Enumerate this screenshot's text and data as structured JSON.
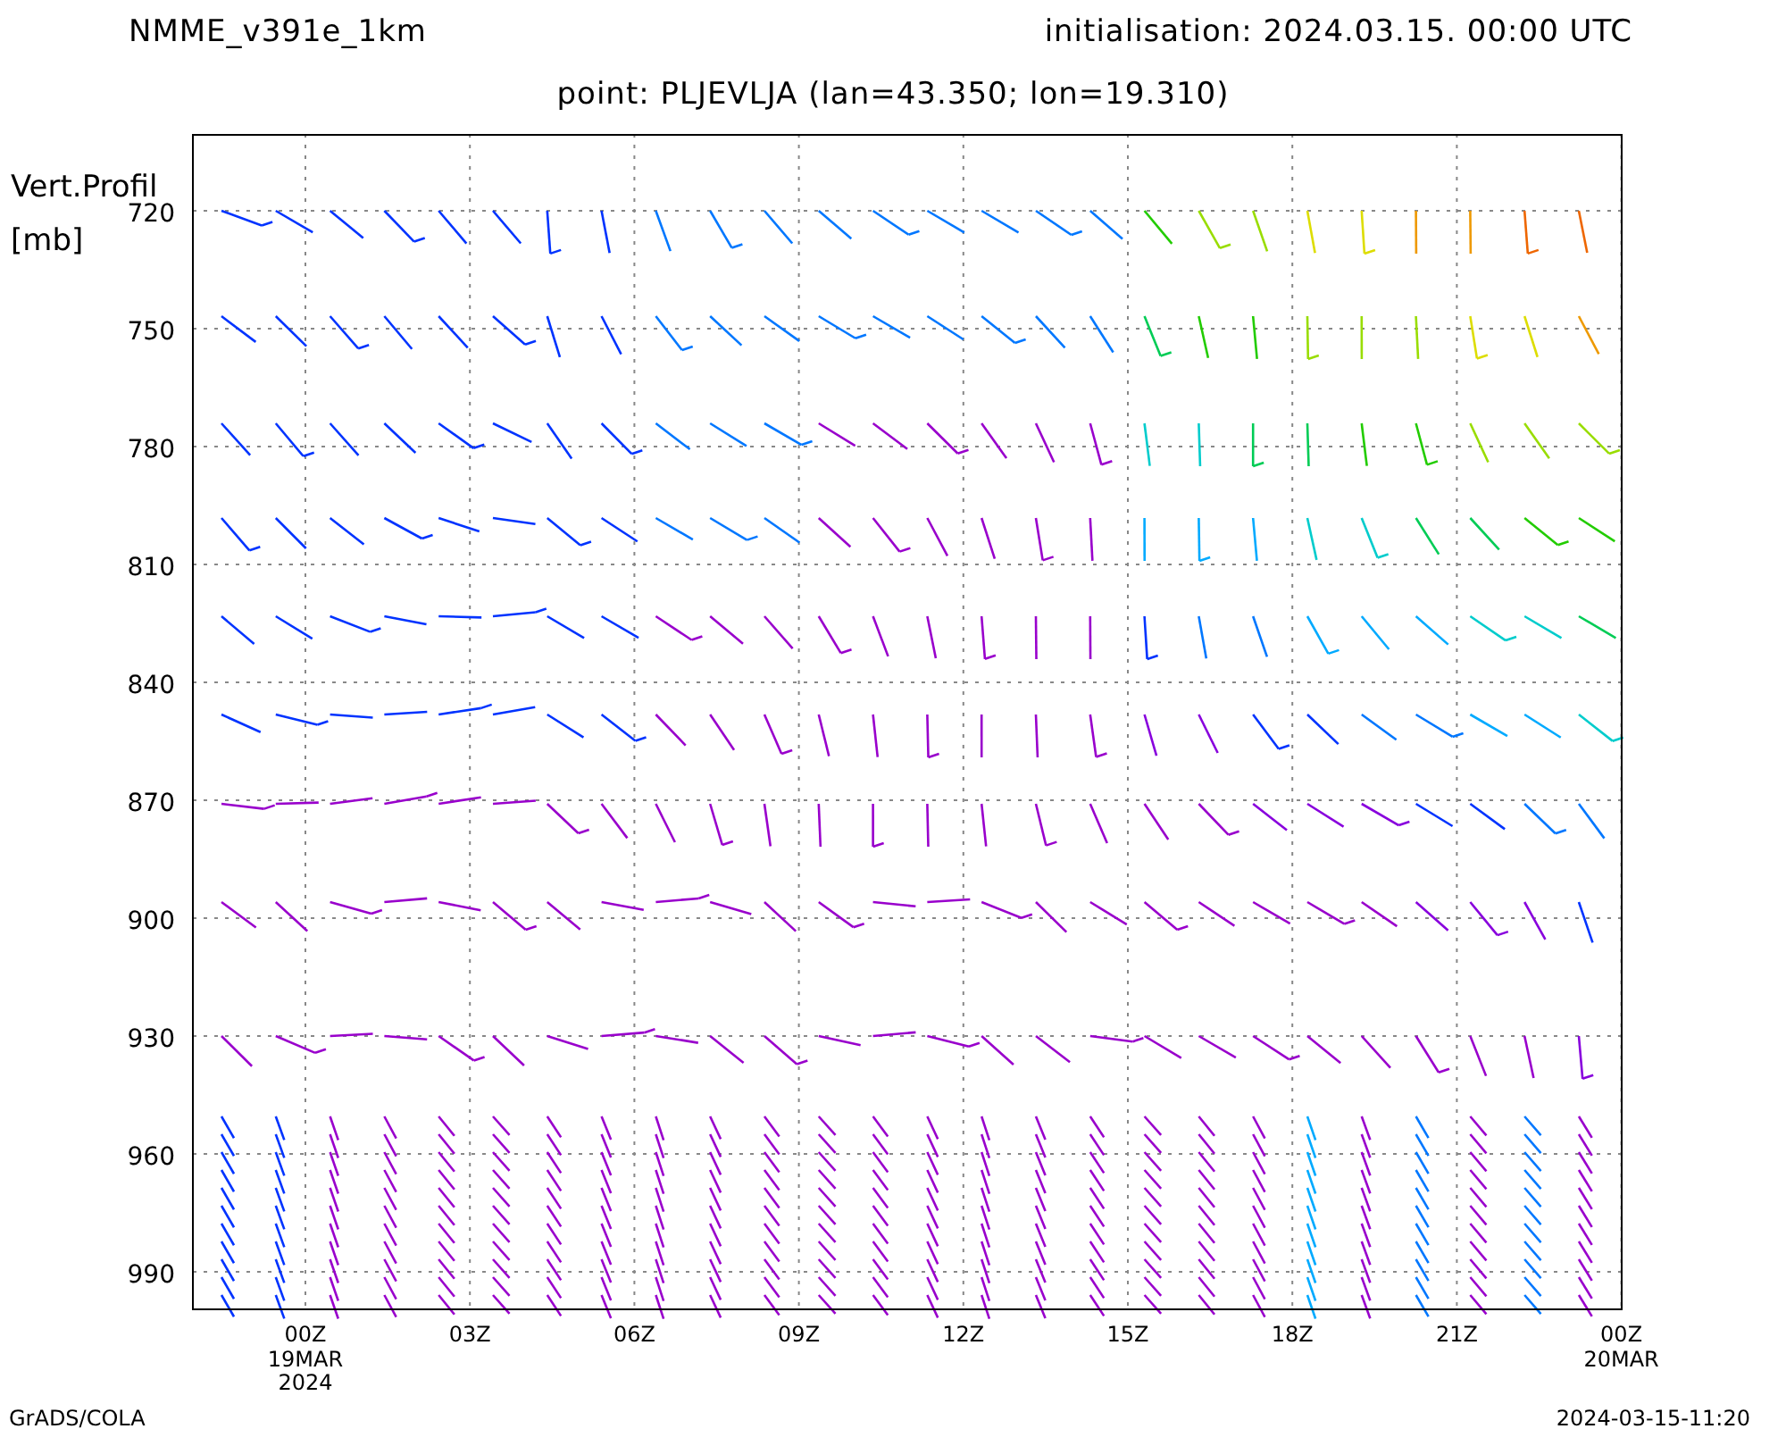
{
  "header": {
    "title": "NMME_v391e_1km",
    "initialisation": "initialisation: 2024.03.15. 00:00 UTC"
  },
  "subtitle": "point: PLJEVLJA (lan=43.350; lon=19.310)",
  "y_axis": {
    "label_lines": [
      "Vert.Profil",
      "[mb]"
    ],
    "ticks": [
      "720",
      "750",
      "780",
      "810",
      "840",
      "870",
      "900",
      "930",
      "960",
      "990"
    ]
  },
  "x_axis": {
    "ticks": [
      {
        "label": "00Z",
        "sub": [
          "19MAR",
          "2024"
        ]
      },
      {
        "label": "03Z"
      },
      {
        "label": "06Z"
      },
      {
        "label": "09Z"
      },
      {
        "label": "12Z"
      },
      {
        "label": "15Z"
      },
      {
        "label": "18Z"
      },
      {
        "label": "21Z"
      },
      {
        "label": "00Z",
        "sub": [
          "20MAR"
        ]
      }
    ]
  },
  "footer": {
    "left": "GrADS/COLA",
    "right": "2024-03-15-11:20"
  }
}
